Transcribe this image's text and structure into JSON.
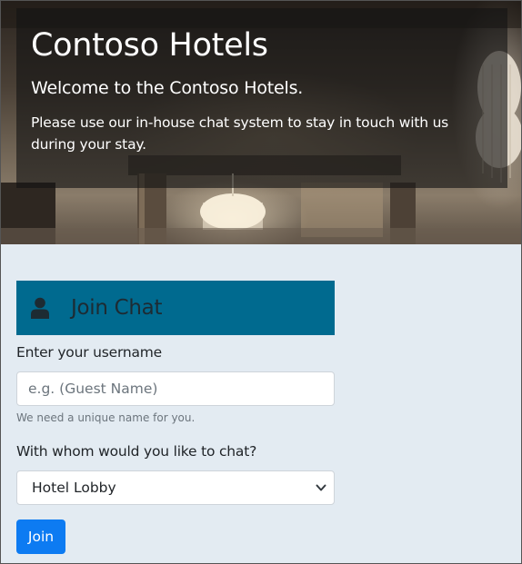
{
  "hero": {
    "title": "Contoso Hotels",
    "subtitle": "Welcome to the Contoso Hotels.",
    "description": "Please use our in-house chat system to stay in touch with us during your stay.",
    "image_icon": "hotel-lobby-chandelier-image"
  },
  "card": {
    "icon": "user-icon",
    "title": "Join Chat",
    "header_color": "#006a8f"
  },
  "form": {
    "username_label": "Enter your username",
    "username_placeholder": "e.g. (Guest Name)",
    "username_value": "",
    "username_help": "We need a unique name for you.",
    "chat_with_label": "With whom would you like to chat?",
    "chat_with_selected": "Hotel Lobby",
    "join_label": "Join",
    "join_color": "#0d7bf2"
  }
}
